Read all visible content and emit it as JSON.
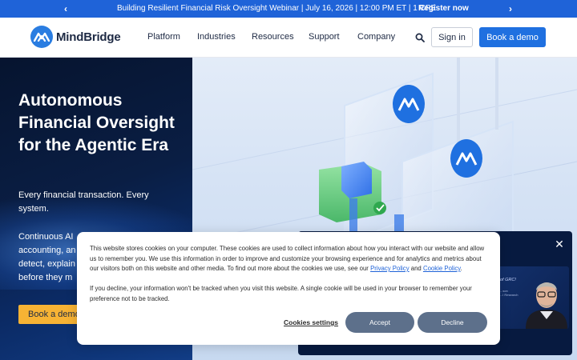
{
  "announcement": {
    "message": "Building Resilient Financial Risk Oversight Webinar | July 16, 2026 | 12:00 PM ET | 1 CPE",
    "cta": "Register now",
    "prev_arrow": "‹",
    "next_arrow": "›"
  },
  "header": {
    "brand": "MindBridge",
    "nav": [
      "Platform",
      "Industries",
      "Resources",
      "Support",
      "Company"
    ],
    "sign_in": "Sign in",
    "book_demo": "Book a demo"
  },
  "hero": {
    "title": "Autonomous Financial Oversight for the Agentic Era",
    "subtitle": "Every financial transaction. Every system.",
    "body": "Continuous AI ... accounting, an... detect, explain... before they m...",
    "body_lines": [
      "Continuous AI",
      "accounting, an",
      "detect, explain",
      "before they m"
    ],
    "cta": "Book a demo"
  },
  "cookie_banner": {
    "paragraph1_pre": "This website stores cookies on your computer. These cookies are used to collect information about how you interact with our website and allow us to remember you. We use this information in order to improve and customize your browsing experience and for analytics and metrics about our visitors both on this website and other media. To find out more about the cookies we use, see our ",
    "privacy_link": "Privacy Policy",
    "and_text": " and ",
    "cookie_link": "Cookie Policy",
    "period": ".",
    "paragraph2": "If you decline, your information won't be tracked when you visit this website. A single cookie will be used in your browser to remember your preference not to be tracked.",
    "settings": "Cookies settings",
    "accept": "Accept",
    "decline": "Decline"
  },
  "webinar_popup": {
    "close": "✕",
    "thumb_title": "of GRC!",
    "thumb_line1": "...son",
    "thumb_line2": "...l Research"
  },
  "colors": {
    "brand_blue": "#1f70e0",
    "announce_bg": "#1f63d8",
    "hero_dark": "#06142f",
    "cta_yellow": "#f7b334",
    "cookie_button": "#5d708b"
  },
  "icons": {
    "search": "search-icon",
    "logo": "mindbridge-logo-icon",
    "close": "close-icon"
  }
}
